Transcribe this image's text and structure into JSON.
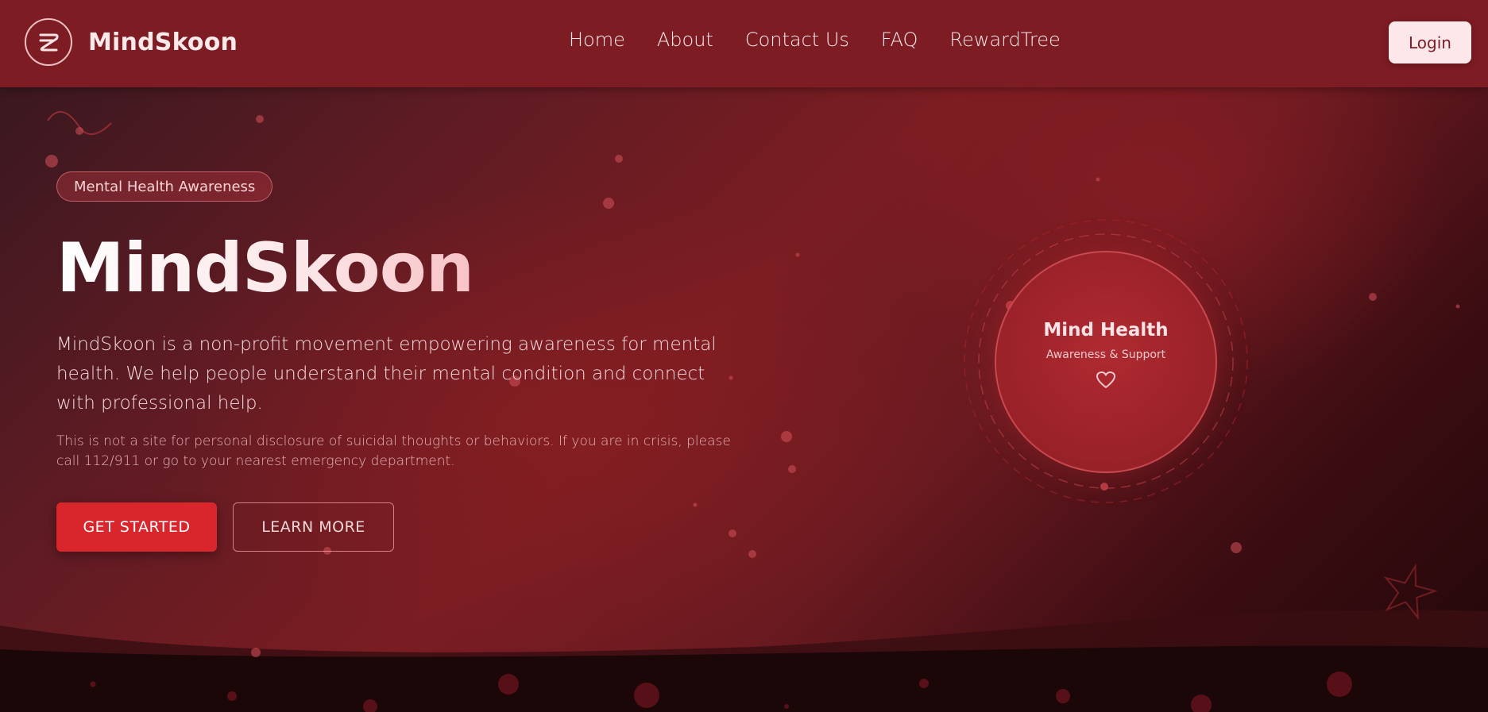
{
  "nav": {
    "brand": "MindSkoon",
    "links": [
      "Home",
      "About",
      "Contact Us",
      "FAQ",
      "RewardTree"
    ],
    "login_label": "Login"
  },
  "hero": {
    "badge": "Mental Health Awareness",
    "title": "MindSkoon",
    "description": "MindSkoon is a non-profit movement empowering awareness for mental health. We help people understand their mental condition and connect with professional help.",
    "note": "This is not a site for personal disclosure of suicidal thoughts or behaviors. If you are in crisis, please call 112/911 or go to your nearest emergency department.",
    "primary_button": "GET STARTED",
    "secondary_button": "LEARN MORE"
  },
  "feature_circle": {
    "title": "Mind Health",
    "subtitle": "Awareness & Support",
    "icon": "heart-icon"
  },
  "colors": {
    "navbar": "#7d1c22",
    "accent": "#d8262c",
    "login_bg": "#fde7ea"
  }
}
